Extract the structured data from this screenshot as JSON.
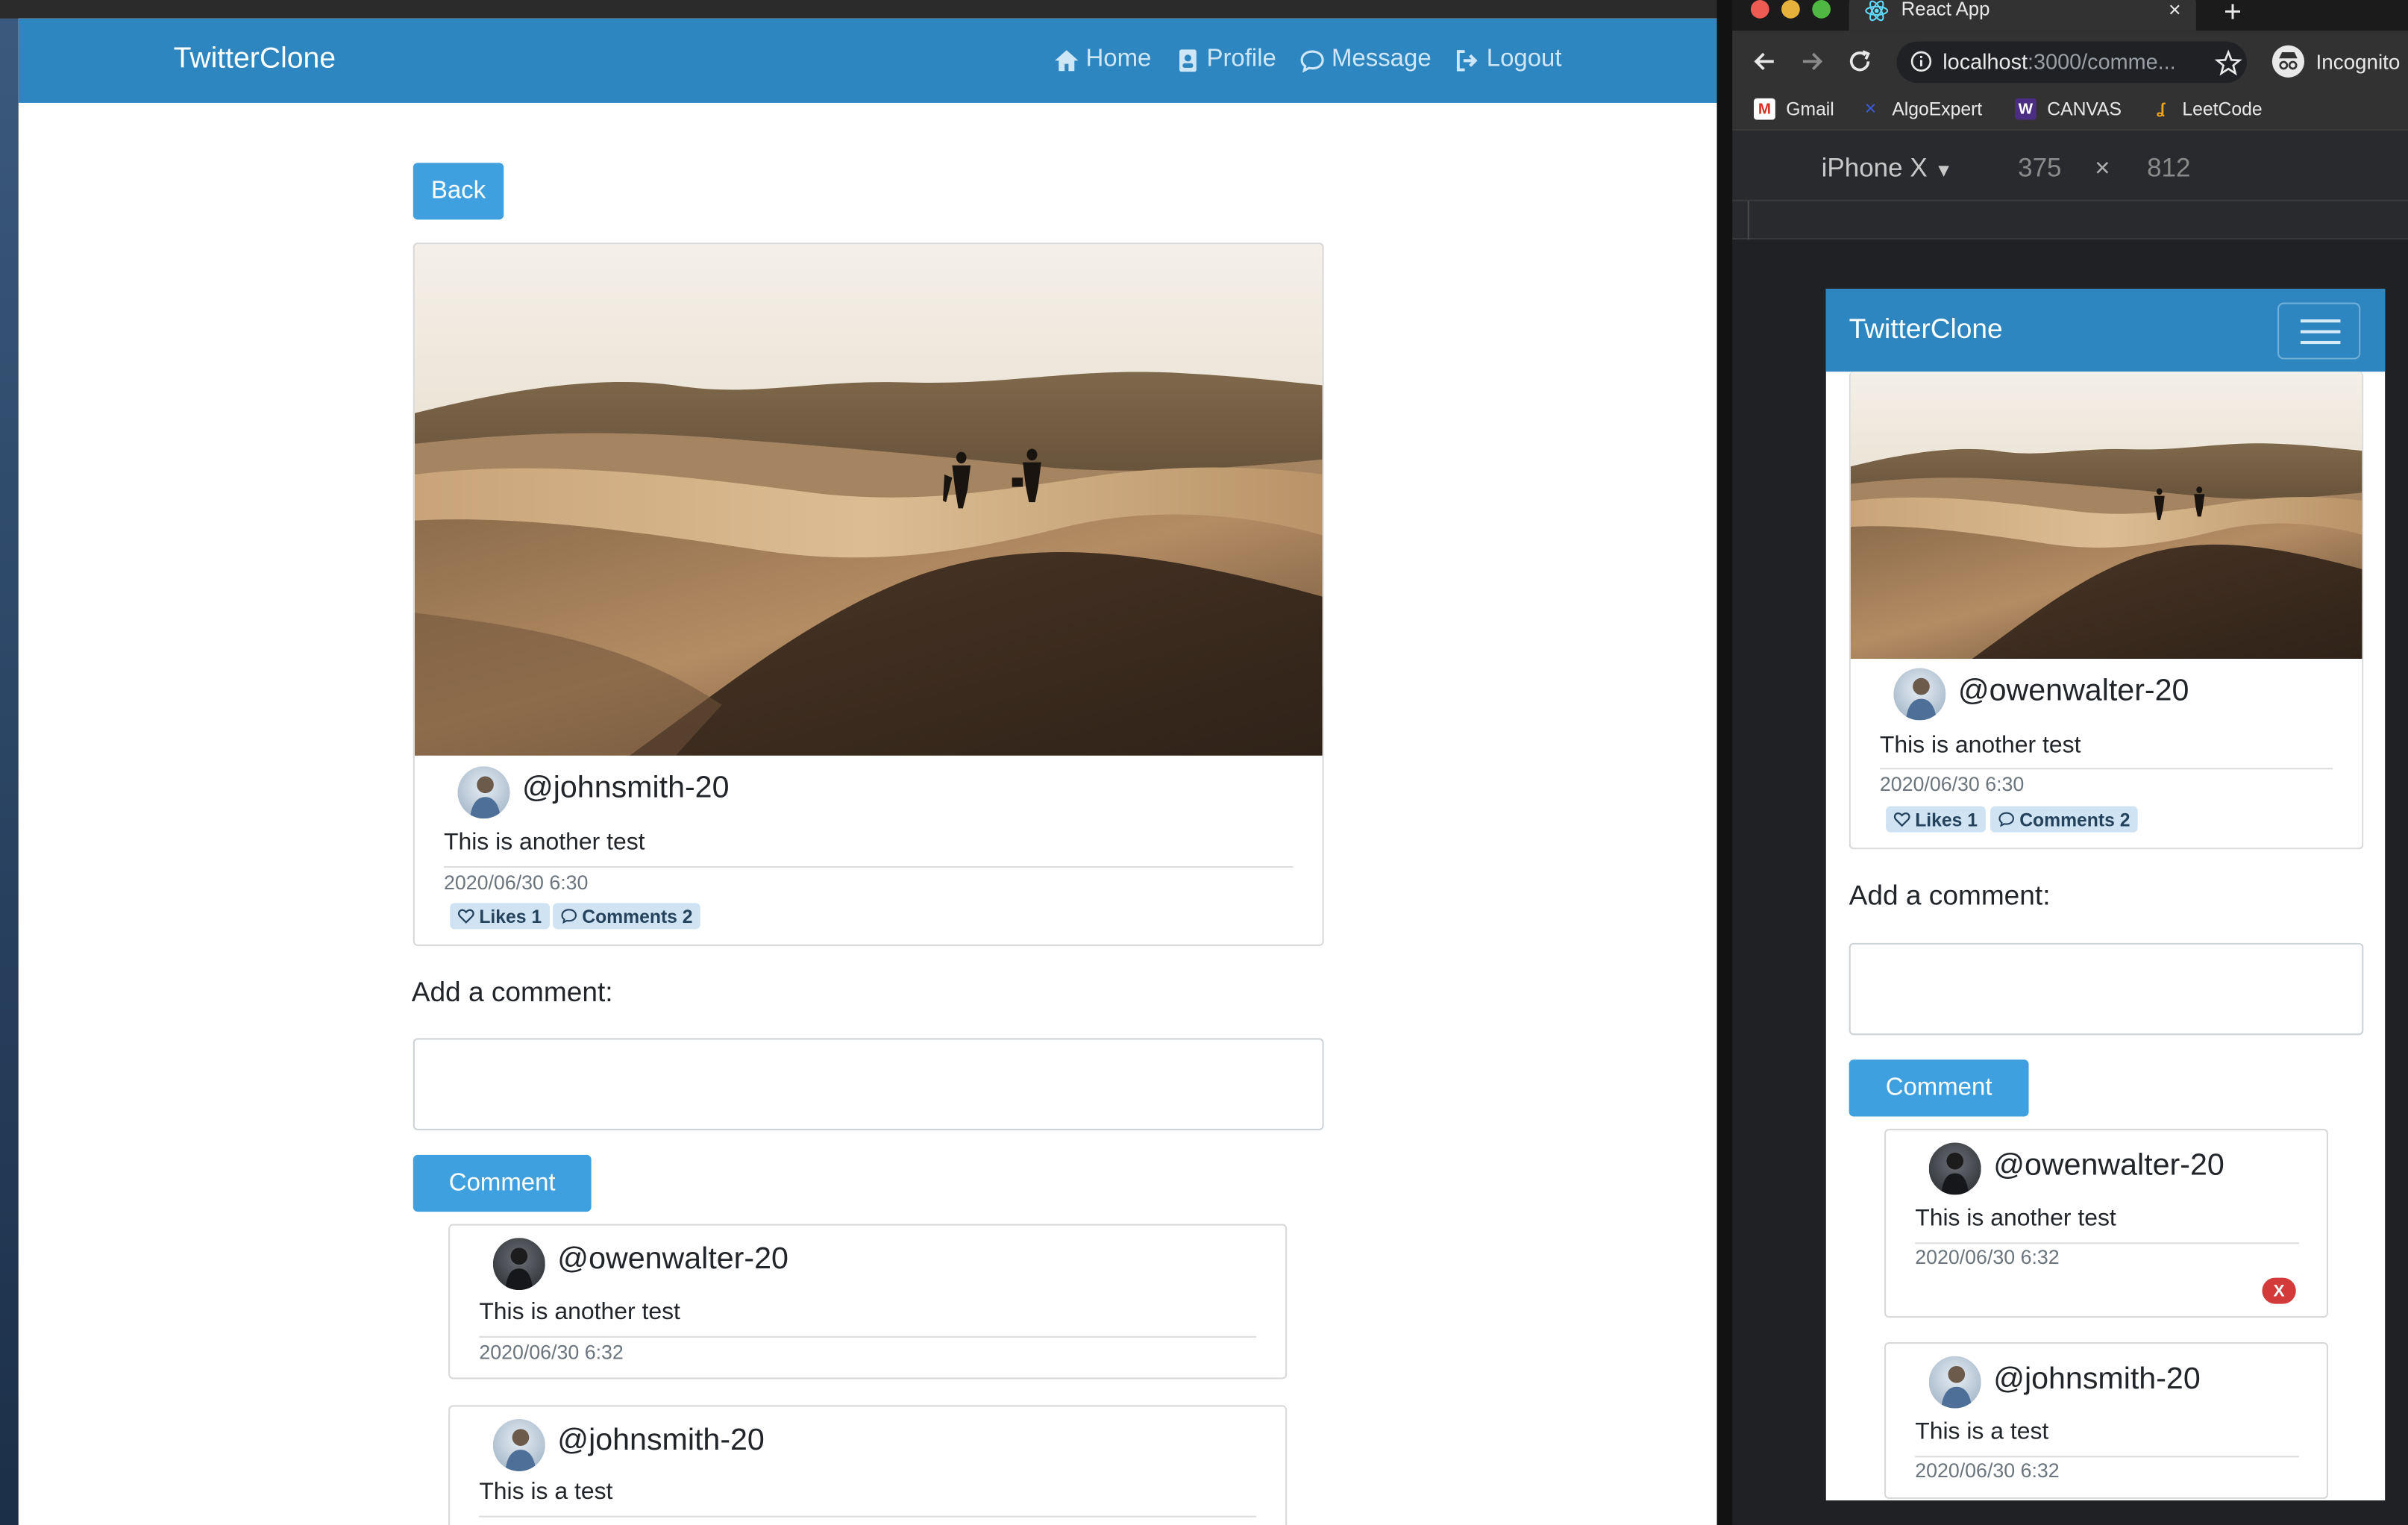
{
  "desktop": {
    "brand": "TwitterClone",
    "nav": [
      {
        "label": "Home",
        "icon": "home-icon"
      },
      {
        "label": "Profile",
        "icon": "profile-icon"
      },
      {
        "label": "Message",
        "icon": "message-icon"
      },
      {
        "label": "Logout",
        "icon": "logout-icon"
      }
    ],
    "back_label": "Back",
    "post": {
      "handle": "@johnsmith-20",
      "text": "This is another test",
      "timestamp": "2020/06/30 6:30",
      "likes_label": "Likes 1",
      "comments_label": "Comments 2"
    },
    "add_comment_label": "Add a comment:",
    "comment_button": "Comment",
    "comments": [
      {
        "handle": "@owenwalter-20",
        "text": "This is another test",
        "timestamp": "2020/06/30 6:32"
      },
      {
        "handle": "@johnsmith-20",
        "text": "This is a test"
      }
    ]
  },
  "browser": {
    "tab_title": "React App",
    "tab_close": "×",
    "new_tab": "+",
    "url_host": "localhost",
    "url_rest": ":3000/comme...",
    "incognito_label": "Incognito",
    "bookmarks": [
      {
        "label": "Gmail",
        "icon": "gmail-icon"
      },
      {
        "label": "AlgoExpert",
        "icon": "algoexpert-icon"
      },
      {
        "label": "CANVAS",
        "icon": "canvas-icon"
      },
      {
        "label": "LeetCode",
        "icon": "leetcode-icon"
      }
    ],
    "device": "iPhone X",
    "device_caret": "▼",
    "width": "375",
    "times": "×",
    "height": "812"
  },
  "mobile": {
    "brand": "TwitterClone",
    "post": {
      "handle": "@owenwalter-20",
      "text": "This is another test",
      "timestamp": "2020/06/30 6:30",
      "likes_label": "Likes 1",
      "comments_label": "Comments 2"
    },
    "add_comment_label": "Add a comment:",
    "comment_button": "Comment",
    "comments": [
      {
        "handle": "@owenwalter-20",
        "text": "This is another test",
        "timestamp": "2020/06/30 6:32",
        "remove_label": "X"
      },
      {
        "handle": "@johnsmith-20",
        "text": "This is a test",
        "timestamp": "2020/06/30 6:32"
      }
    ]
  },
  "colors": {
    "navbar": "#2d86c0",
    "primary_button": "#3fa0df",
    "badge_bg": "#cfe3f3",
    "danger": "#d33a3a"
  }
}
